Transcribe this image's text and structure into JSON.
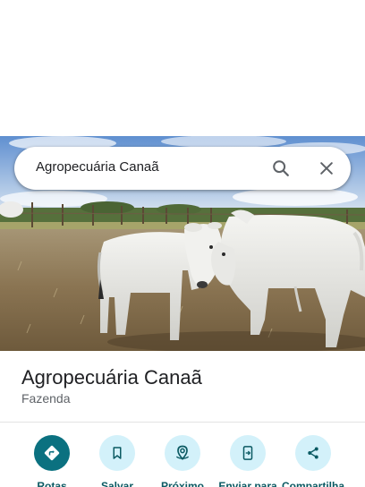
{
  "search": {
    "query": "Agropecuária Canaã",
    "search_icon": "search-icon",
    "close_icon": "close-icon"
  },
  "place": {
    "name": "Agropecuária Canaã",
    "category": "Fazenda",
    "photo_alt": "Gado Nelore em pasto"
  },
  "actions": [
    {
      "label": "Rotas",
      "icon": "directions-icon",
      "primary": true
    },
    {
      "label": "Salvar",
      "icon": "bookmark-icon",
      "primary": false
    },
    {
      "label": "Próximo",
      "icon": "nearby-icon",
      "primary": false
    },
    {
      "label": "Enviar para",
      "icon": "send-to-phone-icon",
      "primary": false
    },
    {
      "label": "Compartilha",
      "icon": "share-icon",
      "primary": false
    }
  ],
  "colors": {
    "accent": "#0b7180",
    "action_bg": "#d3f1fa",
    "action_label": "#0b5a63"
  }
}
